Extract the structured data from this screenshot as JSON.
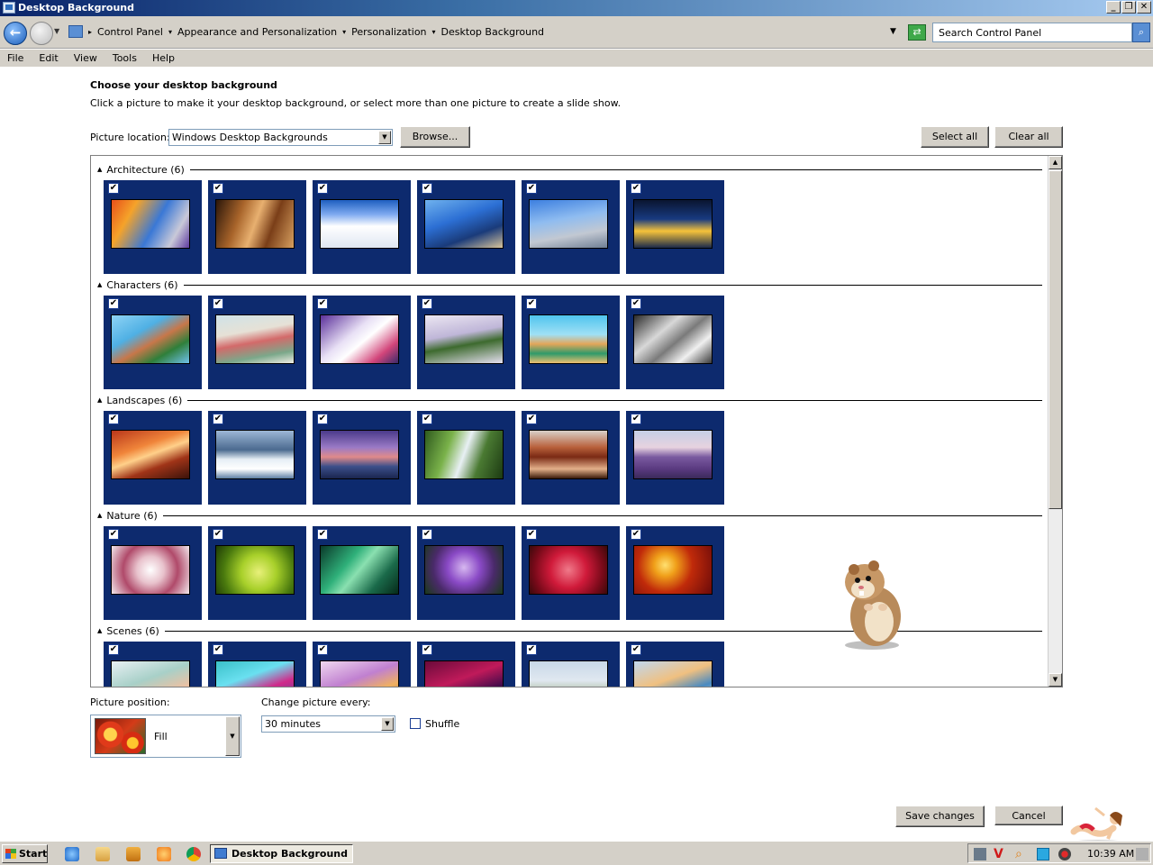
{
  "window": {
    "title": "Desktop Background"
  },
  "address": {
    "crumbs": [
      "Control Panel",
      "Appearance and Personalization",
      "Personalization",
      "Desktop Background"
    ],
    "search_placeholder": "Search Control Panel"
  },
  "menu": [
    "File",
    "Edit",
    "View",
    "Tools",
    "Help"
  ],
  "page": {
    "heading": "Choose your desktop background",
    "subheading": "Click a picture to make it your desktop background, or select more than one picture to create a slide show.",
    "location_label": "Picture location:",
    "location_value": "Windows Desktop Backgrounds",
    "browse_label": "Browse...",
    "select_all_label": "Select all",
    "clear_all_label": "Clear all"
  },
  "groups": [
    {
      "label": "Architecture (6)",
      "thumbs": [
        "linear-gradient(120deg,#e8501a 0%,#f5a32a 25%,#3a78d6 55%,#c9c9d8 80%,#5e3aa0 100%)",
        "linear-gradient(110deg,#2b170a 0%,#a8642a 30%,#e8b070 50%,#7a3e18 70%,#d7a060 100%)",
        "linear-gradient(180deg,#1e5ec0 0%,#7eaaf0 30%,#ffffff 55%,#dfe6f2 100%)",
        "linear-gradient(160deg,#6fb2ee 0%,#2c6fd4 40%,#1a3b7a 70%,#d8c49a 100%)",
        "linear-gradient(170deg,#3c7fe0 0%,#8fbcf0 40%,#c2c8d2 70%,#6f7f95 100%)",
        "linear-gradient(180deg,#0a1530 0%,#183a80 40%,#f6c33a 65%,#1b2a4a 100%)"
      ]
    },
    {
      "label": "Characters (6)",
      "thumbs": [
        "linear-gradient(150deg,#8fd3f5 0%,#4fb0e4 35%,#c7774a 55%,#2f7f3a 75%,#6fc1ec 100%)",
        "linear-gradient(170deg,#cfe3e8 0%,#e6e1d6 35%,#d36a6a 55%,#7ba88a 80%,#f0ece4 100%)",
        "linear-gradient(140deg,#5a2f9a 0%,#e8e0f5 40%,#ffffff 55%,#d2457a 80%,#3a2a6a 100%)",
        "linear-gradient(170deg,#ece7f2 0%,#bfb6d8 40%,#3d6a2e 60%,#e5dff0 100%)",
        "linear-gradient(180deg,#4fc4ee 0%,#9fe0f5 40%,#e3a65a 60%,#2f9a6a 80%,#f0c070 100%)",
        "linear-gradient(140deg,#2a2a2a 0%,#d8d8d8 35%,#7a7a7a 55%,#f0f0f0 75%,#3a3a3a 100%)"
      ]
    },
    {
      "label": "Landscapes (6)",
      "thumbs": [
        "linear-gradient(160deg,#b8361a 0%,#f0853a 35%,#ffd08a 50%,#a03418 70%,#3a120a 100%)",
        "linear-gradient(180deg,#9db7d6 0%,#4b6a8f 40%,#e6eef5 60%,#ffffff 80%,#5d7fa5 100%)",
        "linear-gradient(180deg,#4a3a8a 0%,#9a7ac6 35%,#e08a8a 55%,#3b4f8a 75%,#1a2550 100%)",
        "linear-gradient(110deg,#2f5a1e 0%,#7ab24a 30%,#e8f0f4 50%,#4a7a32 70%,#1c3a12 100%)",
        "linear-gradient(180deg,#d9d0c8 0%,#b8603a 35%,#7a2a14 55%,#e3b08a 80%,#3a1a0a 100%)",
        "linear-gradient(180deg,#c5cfe6 0%,#e7d2df 35%,#7a5aa0 55%,#5a3a80 80%,#3a2a5a 100%)"
      ]
    },
    {
      "label": "Nature (6)",
      "thumbs": [
        "radial-gradient(circle at 50% 50%,#ffffff 0%,#e8c2cc 30%,#b04a6a 60%,#f2e8ec 100%)",
        "radial-gradient(circle at 55% 55%,#e8f07a 0%,#a8d02a 35%,#4a7a0e 70%,#1e3a06 100%)",
        "linear-gradient(130deg,#0a3a2a 0%,#2fb07a 35%,#8ae0b0 50%,#1a6a4a 75%,#062a1a 100%)",
        "radial-gradient(circle at 50% 45%,#d7b8f0 0%,#8a4ac6 35%,#4a2a6a 65%,#1a3a1a 100%)",
        "radial-gradient(circle at 50% 50%,#f07a8a 0%,#d01a3a 40%,#7a0a1a 75%,#3a0a0a 100%)",
        "radial-gradient(circle at 40% 40%,#ffe070 0%,#f0a01a 20%,#c02a0a 50%,#6a0a0a 100%)"
      ]
    },
    {
      "label": "Scenes (6)",
      "thumbs": [
        "linear-gradient(160deg,#e8f0f4 0%,#a8d0c8 40%,#f0c0a0 70%,#ffffff 100%)",
        "linear-gradient(160deg,#3ac0c8 0%,#6ae0f0 35%,#d02a8a 60%,#2a4aa0 100%)",
        "linear-gradient(160deg,#f0d8f0 0%,#c080d0 40%,#f0b060 65%,#8a4a2a 100%)",
        "linear-gradient(160deg,#6a0a3a 0%,#c01a5a 40%,#3a0a4a 70%,#1a0a1a 100%)",
        "linear-gradient(180deg,#c8d8e8 0%,#e0e8f0 40%,#b0c0a8 65%,#6a8a9a 100%)",
        "linear-gradient(160deg,#c0d8f0 0%,#f0c080 40%,#4a8ac0 65%,#d0e8f0 100%)"
      ]
    }
  ],
  "bottom": {
    "position_label": "Picture position:",
    "position_value": "Fill",
    "change_label": "Change picture every:",
    "change_value": "30 minutes",
    "shuffle_label": "Shuffle",
    "save_label": "Save changes",
    "cancel_label": "Cancel"
  },
  "taskbar": {
    "start_label": "Start",
    "task_label": "Desktop Background",
    "clock": "10:39 AM"
  },
  "colors": {
    "tile_bg": "#0d2a6e",
    "title_gradient_start": "#0a246a",
    "chrome": "#d4d0c8"
  }
}
